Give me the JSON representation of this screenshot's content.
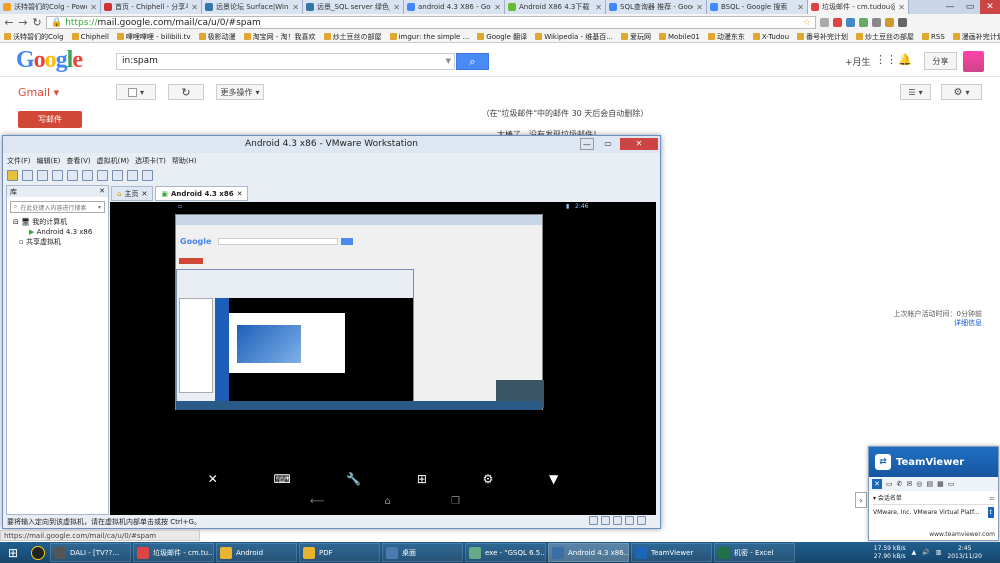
{
  "browser": {
    "tabs": [
      {
        "label": "沃特碧们的Colg - Powe",
        "color": "#f0a020"
      },
      {
        "label": "首页 - Chiphell - 分享与",
        "color": "#c33"
      },
      {
        "label": "远景论坛 Surface|Win8",
        "color": "#37a"
      },
      {
        "label": "远景_SQL server 绿色_3",
        "color": "#37a"
      },
      {
        "label": "android 4.3 X86 - Goo",
        "color": "#48f"
      },
      {
        "label": "Android X86 4.3下载 安",
        "color": "#6b3"
      },
      {
        "label": "SQL查询器 推荐 - Googl",
        "color": "#48f"
      },
      {
        "label": "BSQL - Google 搜索",
        "color": "#48f"
      },
      {
        "label": "垃圾邮件 - cm.tudou@",
        "color": "#d44"
      }
    ],
    "url_scheme": "https://",
    "url_rest": "mail.google.com/mail/ca/u/0/#spam",
    "bookmarks": [
      "沃特碧们的Colg",
      "Chiphell",
      "嗶哩嗶哩 - bilibili.tv",
      "极影动漫",
      "淘宝网 - 淘！我喜欢",
      "炒土豆丝の部屋",
      "imgur: the simple ...",
      "Google 翻译",
      "Wikipedia - 维基百...",
      "爱玩网",
      "Mobile01",
      "动漫东东",
      "X-Tudou",
      "番号补完计划",
      "炒土豆丝の部屋",
      "RSS",
      "漫画补完计划",
      "其他书签"
    ]
  },
  "gmail": {
    "logo": "Google",
    "search_value": "in:spam",
    "plus_user": "+月生",
    "share_label": "分享",
    "gmail_label": "Gmail",
    "more_label": "更多操作",
    "compose_label": "写邮件",
    "spam_notice": "（在\"垃圾邮件\"中的邮件 30 天后会自动删除）",
    "spam_empty": "太棒了，没有发现垃圾邮件！",
    "last_activity": "上次帐户活动时间：0分钟前",
    "details_link": "详细信息",
    "status_url": "https://mail.google.com/mail/ca/u/0/#spam"
  },
  "vmware": {
    "title": "Android 4.3 x86 - VMware Workstation",
    "menus": [
      "文件(F)",
      "编辑(E)",
      "查看(V)",
      "虚拟机(M)",
      "选项卡(T)",
      "帮助(H)"
    ],
    "library_label": "库",
    "library_search": "在此处键入内容进行搜索",
    "tree_root": "我的计算机",
    "tree_vm": "Android 4.3 x86",
    "tree_shared": "共享虚拟机",
    "tab_home": "主页",
    "tab_vm": "Android 4.3 x86",
    "android_time": "2:46",
    "status_text": "要将输入定向到该虚拟机，请在虚拟机内部单击或按 Ctrl+G。"
  },
  "teamviewer": {
    "title": "TeamViewer",
    "section": "会话名单",
    "entry": "VMware, Inc. VMware Virtual Platf...",
    "url": "www.teamviewer.com"
  },
  "taskbar": {
    "items": [
      {
        "label": "DALI - [TV??…",
        "color": "#555"
      },
      {
        "label": "垃圾邮件 - cm.tu…",
        "color": "#d44"
      },
      {
        "label": "Android",
        "color": "#e8b430"
      },
      {
        "label": "PDF",
        "color": "#e8b430"
      },
      {
        "label": "桌面",
        "color": "#4a7ab0"
      },
      {
        "label": "exe - \"GSQL 6.5…",
        "color": "#6a8"
      },
      {
        "label": "Android 4.3 x86…",
        "color": "#3a6ea5"
      },
      {
        "label": "TeamViewer",
        "color": "#1b66b7"
      },
      {
        "label": "机密 - Excel",
        "color": "#1e7145"
      }
    ],
    "net_up": "17.59 kB/s",
    "net_down": "27.90 kB/s",
    "time": "2:45",
    "date": "2013/11/20"
  }
}
